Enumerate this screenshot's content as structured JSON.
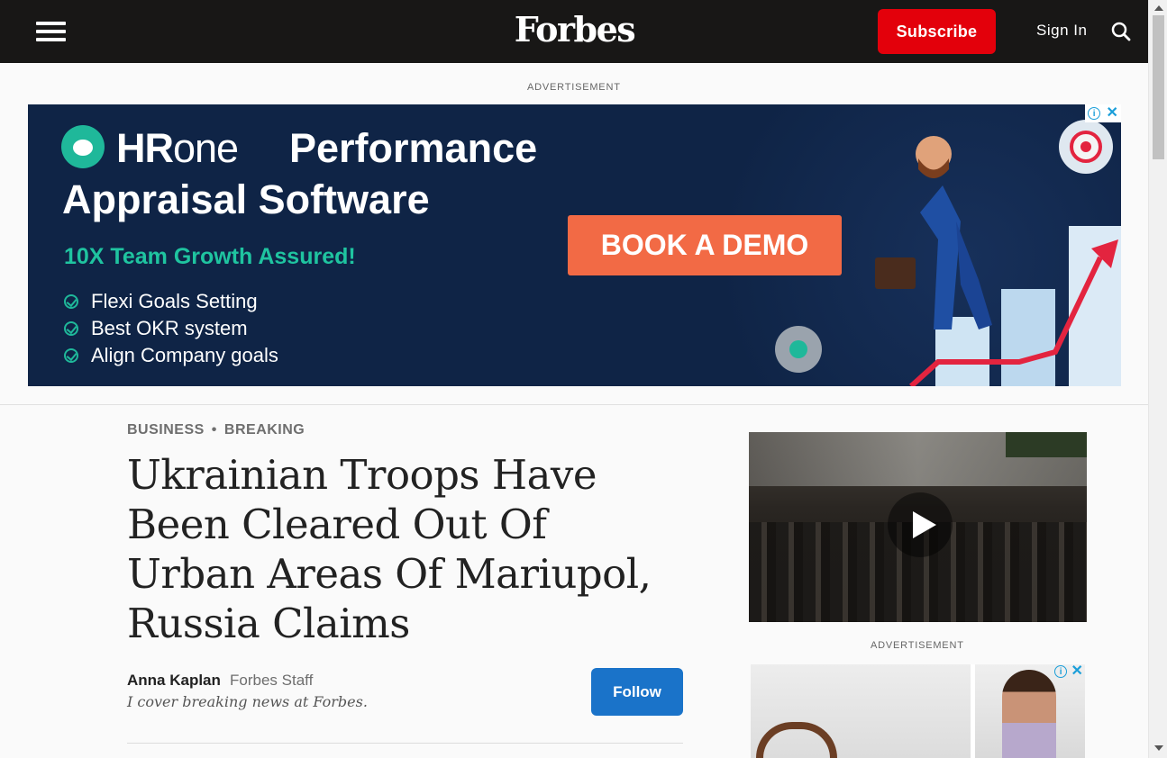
{
  "header": {
    "logo": "Forbes",
    "subscribe_label": "Subscribe",
    "signin_label": "Sign In"
  },
  "ads": {
    "label_top": "ADVERTISEMENT",
    "label_side": "ADVERTISEMENT",
    "banner": {
      "brand_bold": "HR",
      "brand_thin": "one",
      "headline_line1": "Performance",
      "headline_line2": "Appraisal Software",
      "tagline": "10X Team Growth Assured!",
      "features": [
        "Flexi Goals Setting",
        "Best OKR system",
        "Align Company goals"
      ],
      "cta": "BOOK A DEMO",
      "colors": {
        "background": "#0f2446",
        "accent": "#1fc4a0",
        "cta": "#f26a45"
      }
    }
  },
  "article": {
    "channels": [
      "BUSINESS",
      "BREAKING"
    ],
    "headline": "Ukrainian Troops Have Been Cleared Out Of Urban Areas Of Mariupol, Russia Claims",
    "author_name": "Anna Kaplan",
    "author_role": "Forbes Staff",
    "author_bio": "I cover breaking news at Forbes.",
    "follow_label": "Follow"
  },
  "colors": {
    "header_bg": "#181716",
    "subscribe": "#e3000b",
    "follow": "#1a73c9"
  }
}
